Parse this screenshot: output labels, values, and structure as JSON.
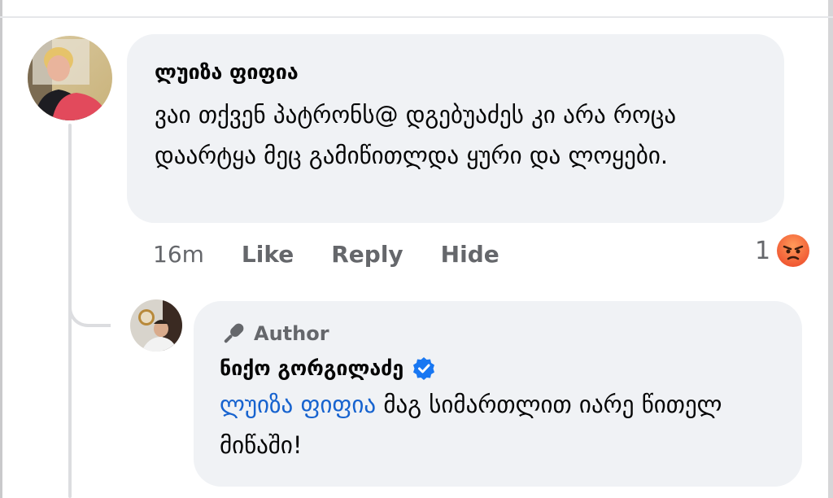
{
  "comment": {
    "author": "ლუიზა ფიფია",
    "text": "ვაი თქვენ პატრონს@ დგებუაძეს კი არა როცა დაარტყა მეც გამიწითლდა ყური და ლოყები.",
    "actions": {
      "time": "16m",
      "like": "Like",
      "reply": "Reply",
      "hide": "Hide"
    },
    "reaction": {
      "count": "1",
      "icon": "angry-emoji-icon"
    }
  },
  "reply": {
    "badge": "Author",
    "badge_icon": "microphone-icon",
    "author": "ნიქო გორგილაძე",
    "verified_icon": "verified-badge-icon",
    "mention": "ლუიზა ფიფია",
    "text": " მაგ სიმართლით იარე წითელ მიწაში!"
  },
  "colors": {
    "bubble": "#f0f2f5",
    "mention": "#1763cf",
    "secondary_text": "#65676b",
    "verified": "#1877f2",
    "angry_emoji": "#f0633c"
  }
}
